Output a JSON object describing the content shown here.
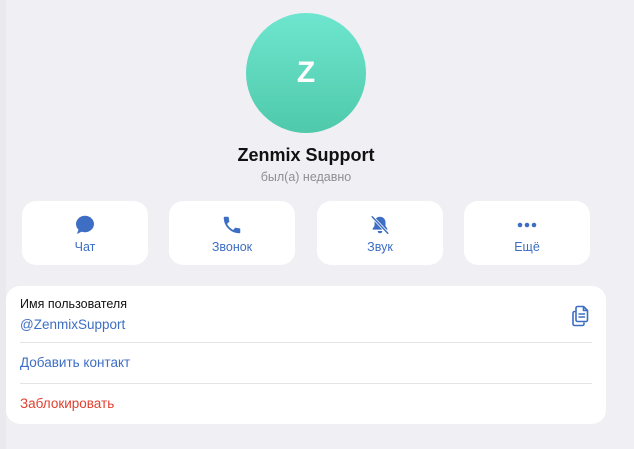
{
  "profile": {
    "avatar_letter": "Z",
    "name": "Zenmix Support",
    "status": "был(а) недавно"
  },
  "actions": [
    {
      "label": "Чат",
      "icon": "chat-bubble-icon"
    },
    {
      "label": "Звонок",
      "icon": "phone-icon"
    },
    {
      "label": "Звук",
      "icon": "bell-muted-icon"
    },
    {
      "label": "Ещё",
      "icon": "more-dots-icon"
    }
  ],
  "info": {
    "username_label": "Имя пользователя",
    "username_value": "@ZenmixSupport",
    "copy_icon": "copy-icon",
    "add_contact_label": "Добавить контакт",
    "block_label": "Заблокировать"
  },
  "colors": {
    "accent": "#3d6ec4",
    "danger": "#e0402f",
    "avatar_top": "#6ee6cf",
    "avatar_bottom": "#4fc9aa",
    "background": "#efeff4"
  }
}
